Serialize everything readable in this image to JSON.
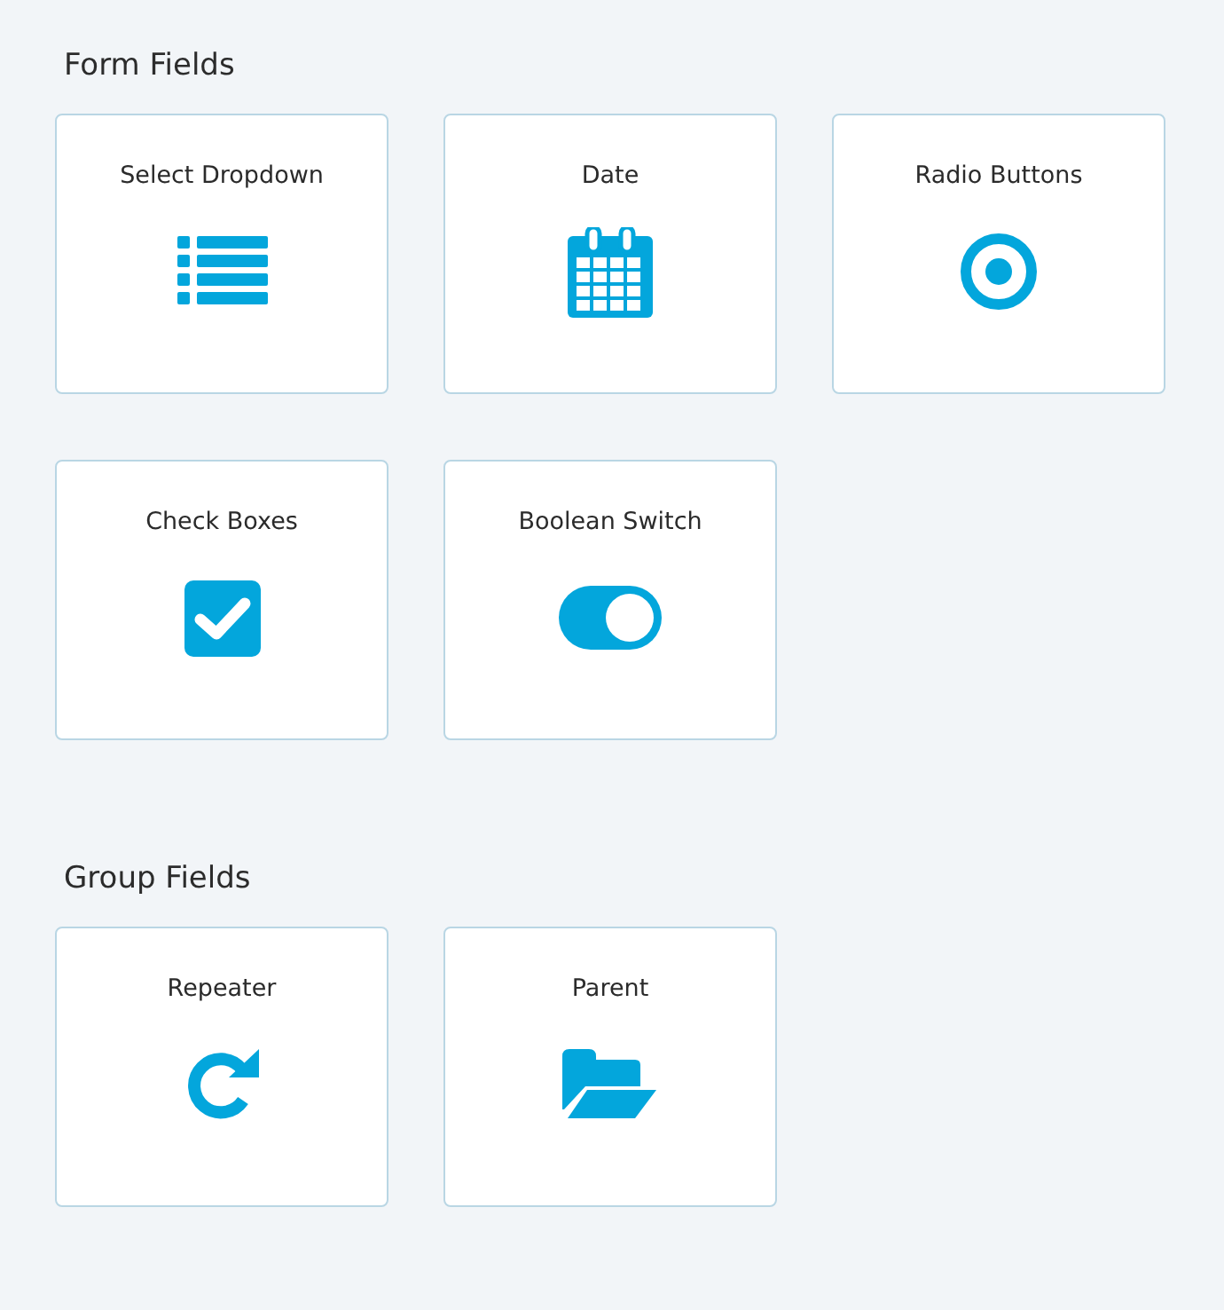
{
  "sections": [
    {
      "title": "Form Fields",
      "cards": [
        {
          "label": "Select Dropdown",
          "kind": "list"
        },
        {
          "label": "Date",
          "kind": "calendar"
        },
        {
          "label": "Radio Buttons",
          "kind": "radio"
        },
        {
          "label": "Check Boxes",
          "kind": "checkbox"
        },
        {
          "label": "Boolean Switch",
          "kind": "toggle"
        }
      ]
    },
    {
      "title": "Group Fields",
      "cards": [
        {
          "label": "Repeater",
          "kind": "refresh"
        },
        {
          "label": "Parent",
          "kind": "folder"
        }
      ]
    }
  ]
}
